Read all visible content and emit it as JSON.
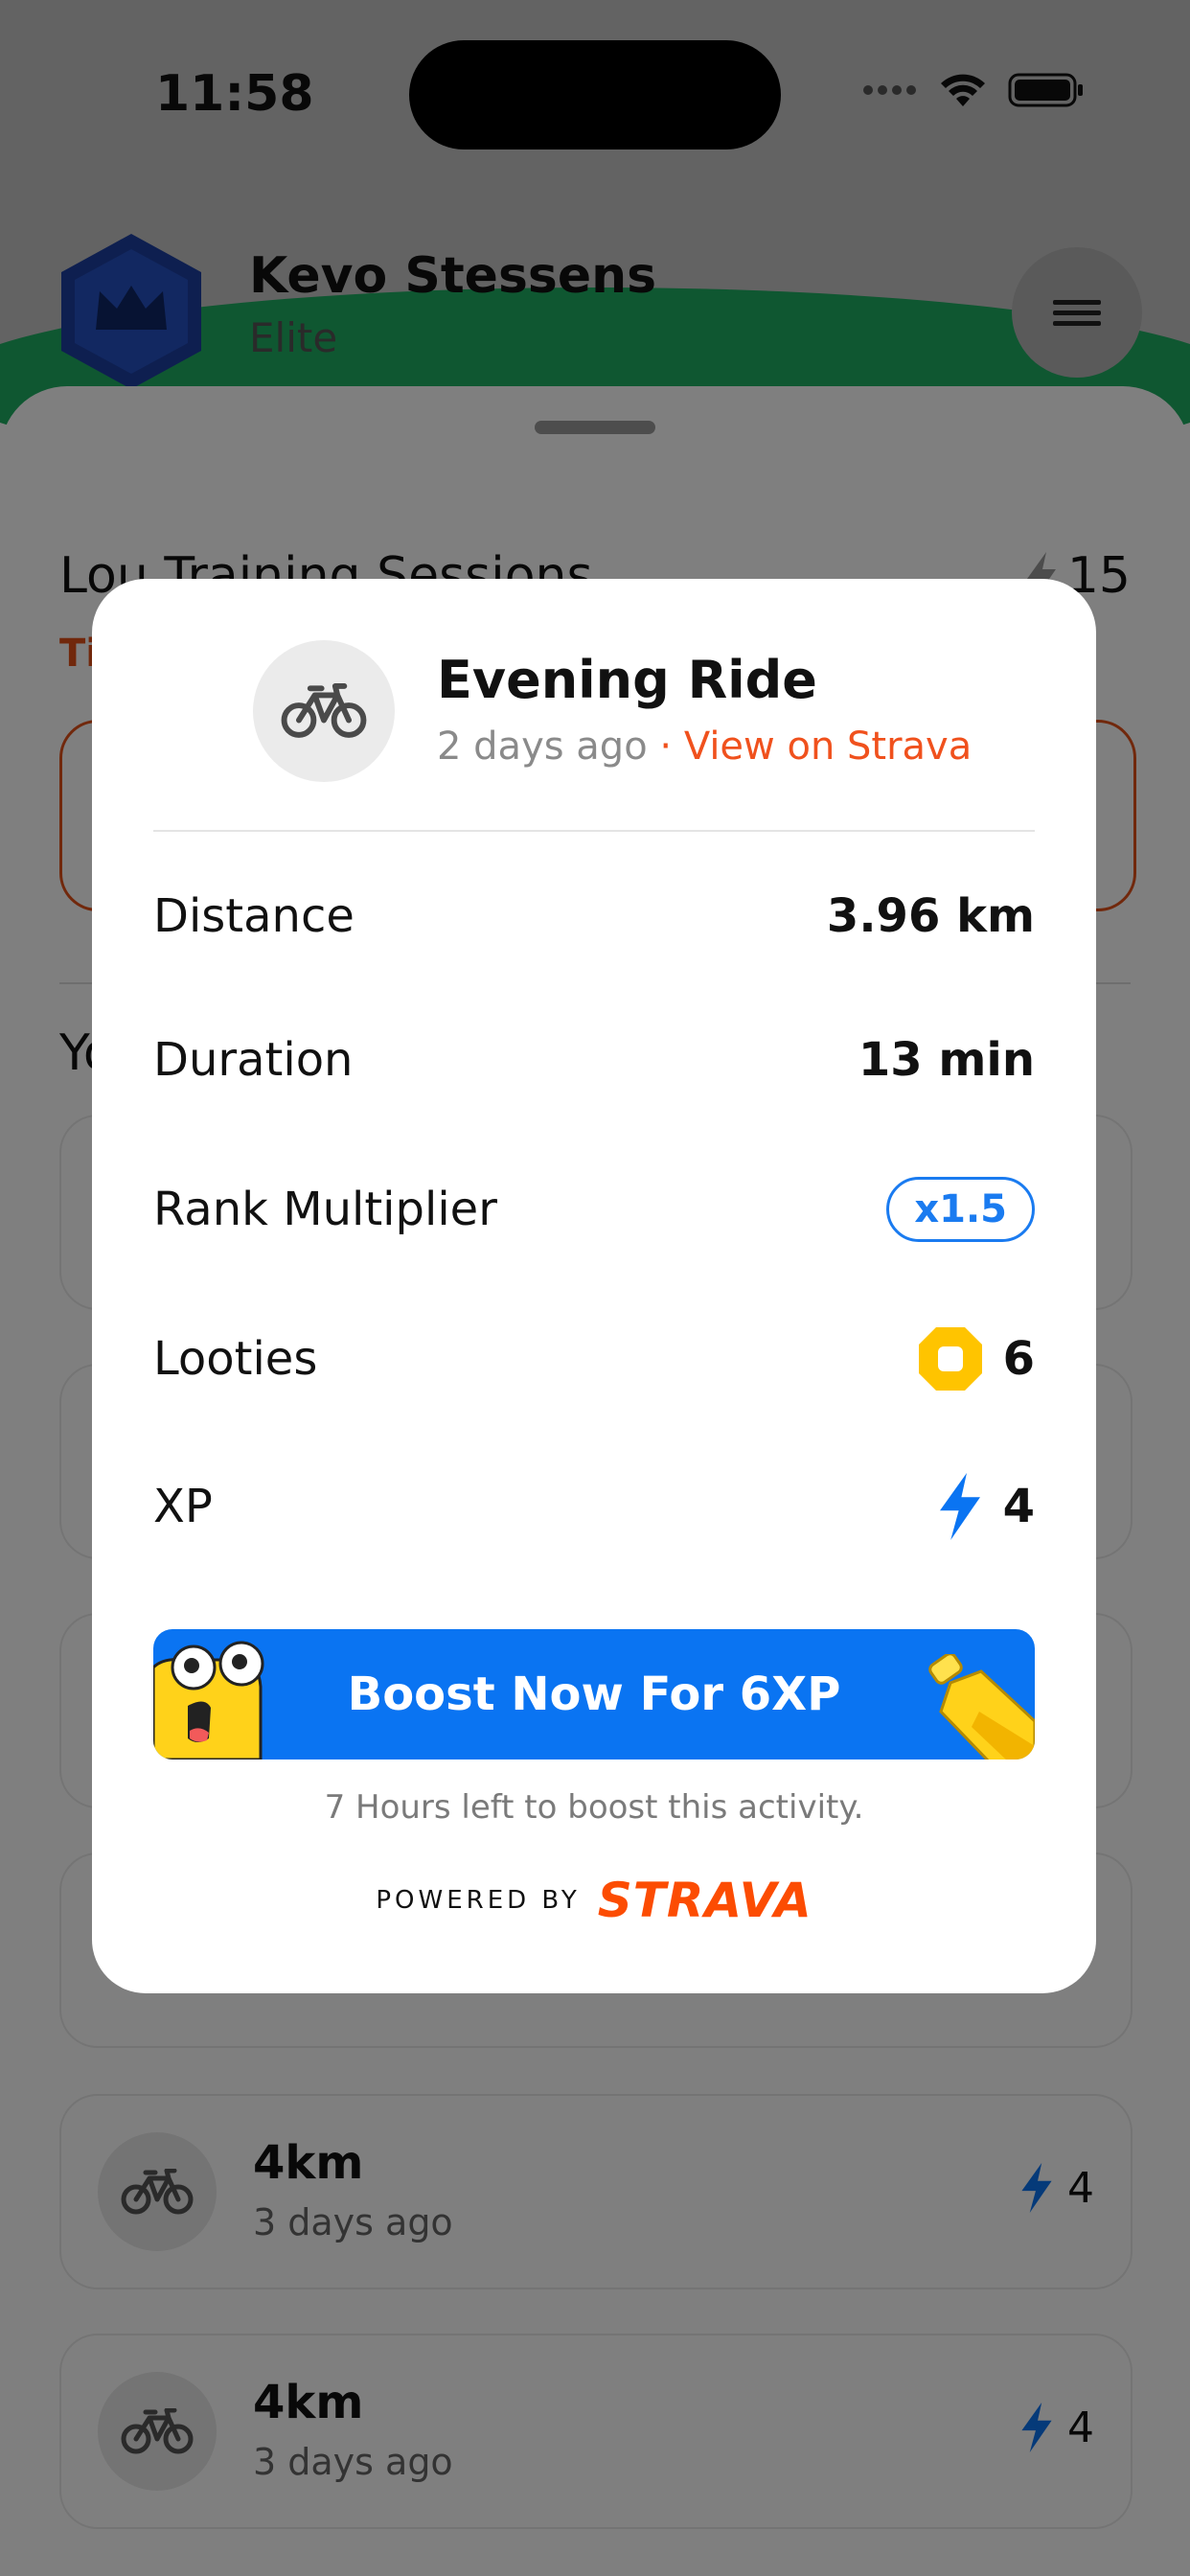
{
  "status_bar": {
    "time": "11:58"
  },
  "user": {
    "name": "Kevo Stessens",
    "rank": "Elite"
  },
  "sessions": {
    "title": "Lou Training Sessions",
    "xp": "15",
    "timer": "Ti"
  },
  "activities_section": {
    "title": "Yo"
  },
  "background_activities": [
    {
      "title": "4km",
      "subtitle": "3 days ago",
      "xp": "4"
    },
    {
      "title": "4km",
      "subtitle": "3 days ago",
      "xp": "4"
    }
  ],
  "modal": {
    "title": "Evening Ride",
    "time_ago": "2 days ago",
    "separator": " · ",
    "strava_link": "View on Strava",
    "rows": {
      "distance": {
        "label": "Distance",
        "value": "3.96 km"
      },
      "duration": {
        "label": "Duration",
        "value": "13 min"
      },
      "multiplier": {
        "label": "Rank Multiplier",
        "value": "x1.5"
      },
      "looties": {
        "label": "Looties",
        "value": "6"
      },
      "xp": {
        "label": "XP",
        "value": "4"
      }
    },
    "boost_button": "Boost Now For 6XP",
    "hours_left": "7 Hours left to boost this activity.",
    "powered_by": "POWERED BY",
    "strava_logo": "STRAVA"
  },
  "colors": {
    "accent_blue": "#0a74f2",
    "strava_orange": "#fc4c02",
    "looties_yellow": "#ffc400",
    "dim_overlay": "rgba(0,0,0,0.5)"
  },
  "icons": [
    "bike-icon",
    "lightning-icon",
    "looties-coin-icon",
    "menu-icon",
    "wifi-icon",
    "battery-icon",
    "crown-icon"
  ]
}
